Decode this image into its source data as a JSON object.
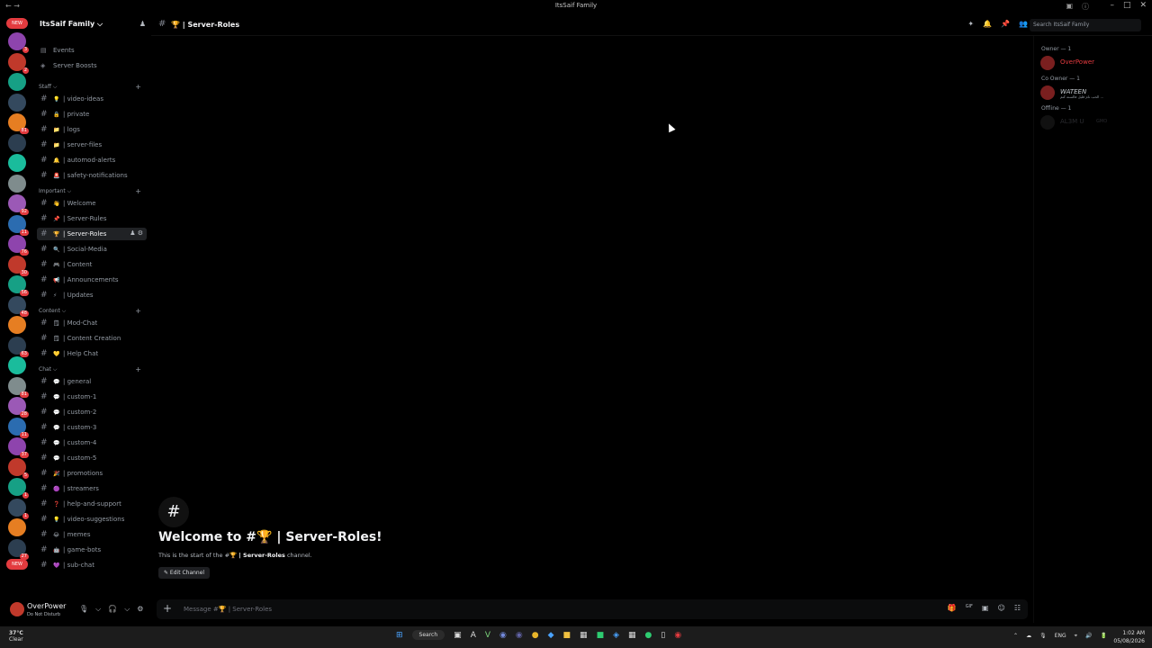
{
  "window": {
    "title": "ItsSaif Family",
    "nav": "←  →",
    "controls": [
      "–",
      "□",
      "✕"
    ],
    "apps": [
      "▣",
      "ⓘ"
    ]
  },
  "guild": {
    "name": "ItsSaif Family ⌵",
    "add_member_icon": "♟"
  },
  "top_items": [
    {
      "label": "Events",
      "icon": "calendar-icon",
      "glyph": "▤"
    },
    {
      "label": "Server Boosts",
      "icon": "boost-icon",
      "glyph": "◈"
    }
  ],
  "categories": [
    {
      "label": "Staff ⌵",
      "channels": [
        {
          "emoji": "💡",
          "label": "| video-ideas"
        },
        {
          "emoji": "🔒",
          "label": "| private"
        },
        {
          "emoji": "📁",
          "label": "| logs"
        },
        {
          "emoji": "📁",
          "label": "| server-files"
        },
        {
          "emoji": "🔔",
          "label": "| automod-alerts"
        },
        {
          "emoji": "🚨",
          "label": "| safety-notifications"
        }
      ]
    },
    {
      "label": "Important ⌵",
      "channels": [
        {
          "emoji": "👋",
          "label": "| Welcome"
        },
        {
          "emoji": "📌",
          "label": "| Server-Rules"
        },
        {
          "emoji": "🏆",
          "label": "| Server-Roles",
          "active": true
        },
        {
          "emoji": "🔍",
          "label": "| Social-Media"
        },
        {
          "emoji": "🎮",
          "label": "| Content"
        },
        {
          "emoji": "📢",
          "label": "| Announcements"
        },
        {
          "emoji": "⚡",
          "label": "| Updates"
        }
      ]
    },
    {
      "label": "Content ⌵",
      "channels": [
        {
          "emoji": "🗒",
          "label": "| Mod-Chat"
        },
        {
          "emoji": "🗒",
          "label": "| Content Creation"
        },
        {
          "emoji": "💛",
          "label": "| Help Chat"
        }
      ]
    },
    {
      "label": "Chat ⌵",
      "channels": [
        {
          "emoji": "💬",
          "label": "| general"
        },
        {
          "emoji": "💬",
          "label": "| custom-1"
        },
        {
          "emoji": "💬",
          "label": "| custom-2"
        },
        {
          "emoji": "💬",
          "label": "| custom-3"
        },
        {
          "emoji": "💬",
          "label": "| custom-4"
        },
        {
          "emoji": "💬",
          "label": "| custom-5"
        },
        {
          "emoji": "🎉",
          "label": "| promotions"
        },
        {
          "emoji": "🟣",
          "label": "| streamers"
        },
        {
          "emoji": "❓",
          "label": "| help-and-support"
        },
        {
          "emoji": "💡",
          "label": "| video-suggestions"
        },
        {
          "emoji": "😂",
          "label": "| memes"
        },
        {
          "emoji": "🤖",
          "label": "| game-bots"
        },
        {
          "emoji": "💜",
          "label": "| sub-chat"
        }
      ]
    }
  ],
  "active_channel_tools": "♟ ⚙",
  "servers": [
    {
      "label": "NEW",
      "type": "new"
    },
    {
      "badge": "3"
    },
    {
      "badge": "2"
    },
    {
      "badge": ""
    },
    {
      "badge": ""
    },
    {
      "badge": "81"
    },
    {
      "badge": ""
    },
    {
      "badge": ""
    },
    {
      "badge": ""
    },
    {
      "badge": "92"
    },
    {
      "badge": "11"
    },
    {
      "badge": "76"
    },
    {
      "badge": "30"
    },
    {
      "badge": "56"
    },
    {
      "badge": "48"
    },
    {
      "badge": ""
    },
    {
      "badge": "63"
    },
    {
      "badge": ""
    },
    {
      "badge": "81"
    },
    {
      "badge": "28"
    },
    {
      "badge": "11"
    },
    {
      "badge": "37"
    },
    {
      "badge": "5"
    },
    {
      "badge": "1"
    },
    {
      "badge": "1"
    },
    {
      "badge": ""
    },
    {
      "badge": "27"
    },
    {
      "label": "NEW",
      "type": "new"
    }
  ],
  "user": {
    "name": "OverPower",
    "status": "Do Not Disturb",
    "controls": [
      "🎙",
      "⌵",
      "🎧",
      "⌵",
      "⚙"
    ]
  },
  "header": {
    "channel": "🏆 | Server-Roles",
    "icons": [
      "✦",
      "🔔",
      "📌",
      "👥"
    ],
    "search_placeholder": "Search ItsSaif Family"
  },
  "welcome": {
    "title": "Welcome to #🏆 | Server-Roles!",
    "sub_prefix": "This is the start of the #",
    "sub_channel": "🏆 | Server-Roles",
    "sub_suffix": " channel.",
    "edit": "✎ Edit Channel"
  },
  "composer": {
    "placeholder": "Message #🏆 | Server-Roles",
    "icons": [
      "🎁",
      "GIF",
      "▣",
      "☺",
      "☷"
    ]
  },
  "members": {
    "groups": [
      {
        "label": "Owner — 1",
        "members": [
          {
            "name": "OverPower",
            "color": "#e33b3f",
            "status": ""
          }
        ]
      },
      {
        "label": "Co Owner — 1",
        "members": [
          {
            "name": "WATEEN",
            "color": "#c4c9ce",
            "status": "الحب نام قليل فالسنه كتم ..."
          }
        ]
      },
      {
        "label": "Offline — 1",
        "members": [
          {
            "name": "AL3M U",
            "color": "#2a2b2f",
            "status": "",
            "tag": "GMO"
          }
        ]
      }
    ]
  },
  "taskbar": {
    "weather_temp": "37°C",
    "weather_desc": "Clear",
    "search": "Search",
    "tray": [
      "⌃",
      "☁",
      "🎙",
      "ENG",
      "⌖",
      "🔊",
      "🔋"
    ],
    "time": "1:02 AM",
    "date": "05/08/2026"
  }
}
